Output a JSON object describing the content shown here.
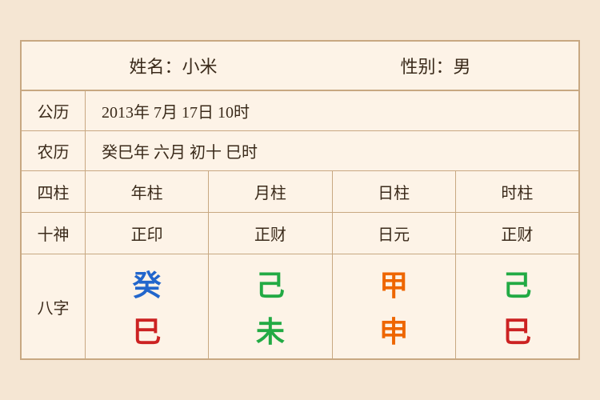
{
  "header": {
    "name_label": "姓名：小米",
    "gender_label": "性别：男"
  },
  "gregorian": {
    "label": "公历",
    "value": "2013年 7月 17日 10时"
  },
  "lunar": {
    "label": "农历",
    "value": "癸巳年 六月 初十 巳时"
  },
  "columns": {
    "label": "四柱",
    "year": "年柱",
    "month": "月柱",
    "day": "日柱",
    "hour": "时柱"
  },
  "shishen": {
    "label": "十神",
    "year": "正印",
    "month": "正财",
    "day": "日元",
    "hour": "正财"
  },
  "bazi": {
    "label": "八字",
    "year_top": "癸",
    "year_bottom": "巳",
    "month_top": "己",
    "month_bottom": "未",
    "day_top": "甲",
    "day_bottom": "申",
    "hour_top": "己",
    "hour_bottom": "巳"
  }
}
